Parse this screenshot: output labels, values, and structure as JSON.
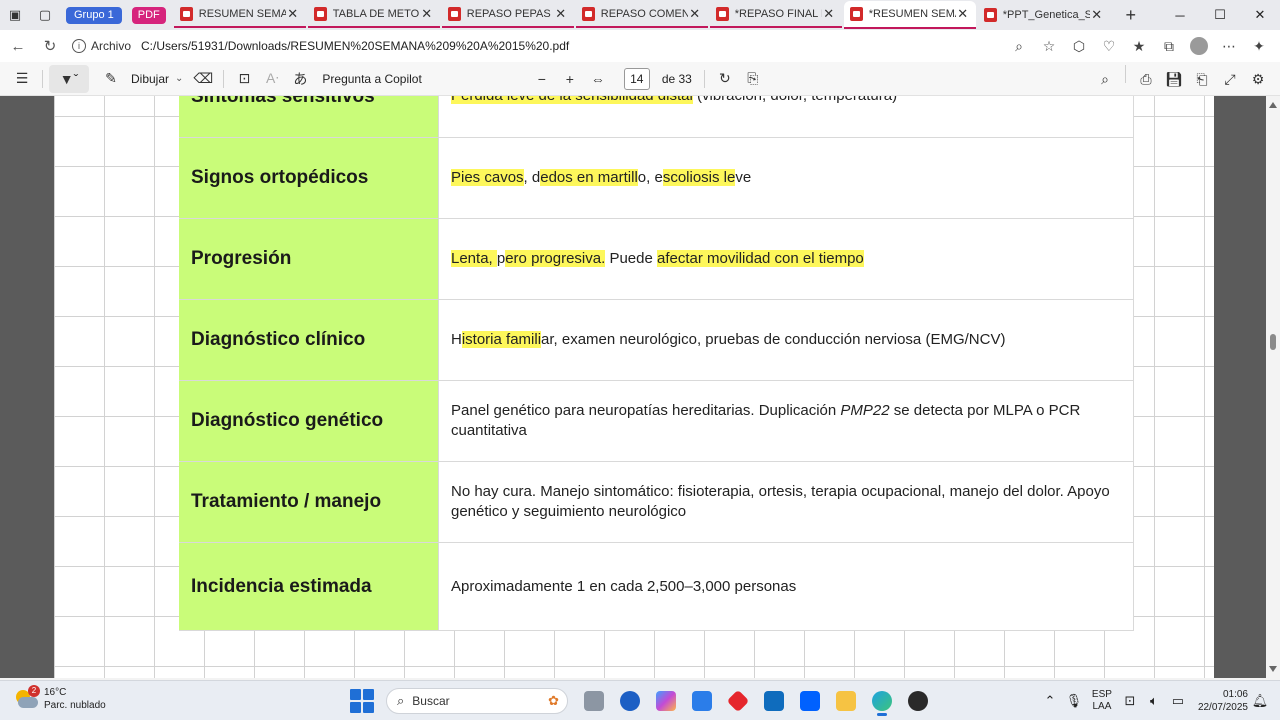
{
  "browser": {
    "group_label": "Grupo 1",
    "pdf_chip_label": "PDF",
    "tabs": [
      {
        "title": "RESUMEN SEMANA"
      },
      {
        "title": "TABLA DE METODOS"
      },
      {
        "title": "REPASO PEPAS MT"
      },
      {
        "title": "REPASO COMENTADO"
      },
      {
        "title": "*REPASO FINAL MT"
      },
      {
        "title": "*RESUMEN SEMANA"
      },
      {
        "title": "*PPT_Genetica_SEM"
      }
    ],
    "new_tab": "+",
    "address": {
      "label": "Archivo",
      "url": "C:/Users/51931/Downloads/RESUMEN%20SEMANA%209%20A%2015%20.pdf"
    }
  },
  "pdf_toolbar": {
    "draw_label": "Dibujar",
    "copilot_label": "Pregunta a Copilot",
    "current_page": "14",
    "page_total": "de 33"
  },
  "document": {
    "rows": [
      {
        "label": "Síntomas sensitivos",
        "value_parts": [
          "Pérdida leve de la sensibilidad distal",
          " (vibración, dolor, temperatura)"
        ]
      },
      {
        "label": "Signos ortopédicos",
        "value_parts": [
          "Pies cavos",
          ", d",
          "edos en martill",
          "o, e",
          "scoliosis le",
          "ve"
        ]
      },
      {
        "label": "Progresión",
        "value_parts": [
          "Lenta, ",
          "p",
          "ero progresiva.",
          " Puede ",
          "afectar movilidad con el tiempo"
        ]
      },
      {
        "label": "Diagnóstico clínico",
        "value_parts": [
          "H",
          "istoria famili",
          "ar, examen neurológico, pruebas de conducción nerviosa (EMG/NCV)"
        ]
      },
      {
        "label": "Diagnóstico genético",
        "value_parts": [
          "Panel genético para neuropatías hereditarias. Duplicación ",
          "PMP22",
          " se detecta por MLPA o PCR cuantitativa"
        ]
      },
      {
        "label": "Tratamiento / manejo",
        "value": "No hay cura. Manejo sintomático: fisioterapia, ortesis, terapia ocupacional, manejo del dolor. Apoyo genético y seguimiento neurológico"
      },
      {
        "label": "Incidencia estimada",
        "value": "Aproximadamente 1 en cada 2,500–3,000 personas"
      }
    ],
    "label_color": "#c9fc79",
    "highlight_color": "#fdf75b"
  },
  "taskbar": {
    "weather_temp": "16°C",
    "weather_desc": "Parc. nublado",
    "weather_badge": "2",
    "search_placeholder": "Buscar",
    "lang_top": "ESP",
    "lang_bottom": "LAA",
    "time": "01:06",
    "date": "22/07/2025"
  }
}
